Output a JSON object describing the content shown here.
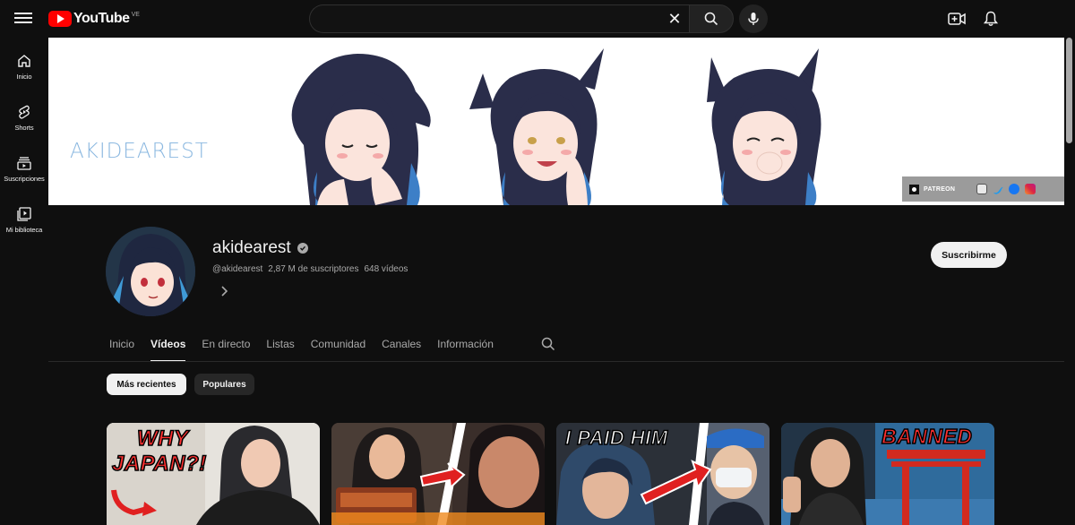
{
  "topbar": {
    "logo_text": "YouTube",
    "logo_region": "VE",
    "search_placeholder": "",
    "search_value": ""
  },
  "sidebar": {
    "items": [
      {
        "label": "Inicio",
        "icon": "home-icon"
      },
      {
        "label": "Shorts",
        "icon": "shorts-icon"
      },
      {
        "label": "Suscripciones",
        "icon": "subscriptions-icon"
      },
      {
        "label": "Mi biblioteca",
        "icon": "library-icon"
      }
    ]
  },
  "banner": {
    "title": "AKIDEAREST",
    "links": {
      "patreon_label": "PATREON",
      "socials": [
        "email-icon",
        "twitter-icon",
        "facebook-icon",
        "instagram-icon"
      ]
    }
  },
  "channel": {
    "name": "akidearest",
    "handle": "@akidearest",
    "subscribers": "2,87 M de suscriptores",
    "videos": "648 vídeos",
    "subscribe_label": "Suscribirme"
  },
  "tabs": [
    {
      "label": "Inicio",
      "active": false
    },
    {
      "label": "Vídeos",
      "active": true
    },
    {
      "label": "En directo",
      "active": false
    },
    {
      "label": "Listas",
      "active": false
    },
    {
      "label": "Comunidad",
      "active": false
    },
    {
      "label": "Canales",
      "active": false
    },
    {
      "label": "Información",
      "active": false
    }
  ],
  "chips": [
    {
      "label": "Más recientes",
      "selected": true
    },
    {
      "label": "Populares",
      "selected": false
    }
  ],
  "videos": [
    {
      "overlay_text_1": "WHY",
      "overlay_text_2": "JAPAN?!"
    },
    {
      "overlay_text_1": "",
      "overlay_text_2": ""
    },
    {
      "overlay_text_1": "I PAID HIM",
      "overlay_text_2": ""
    },
    {
      "overlay_text_1": "BANNED",
      "overlay_text_2": ""
    }
  ],
  "colors": {
    "background": "#0f0f0f",
    "brand_red": "#ff0000",
    "text_primary": "#f1f1f1",
    "text_secondary": "#aaaaaa",
    "banner_title": "#8bb8e0"
  }
}
